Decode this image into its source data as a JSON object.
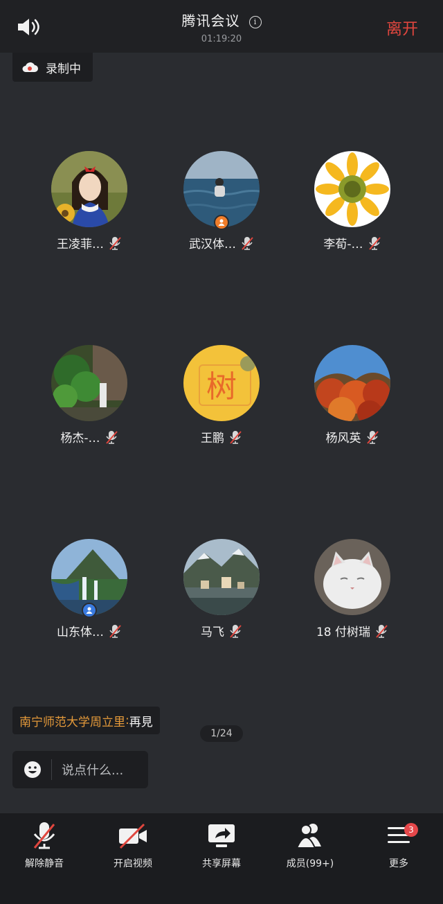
{
  "header": {
    "title": "腾讯会议",
    "timer": "01:19:20",
    "leave_label": "离开",
    "info_glyph": "i"
  },
  "recording": {
    "label": "录制中"
  },
  "participants": [
    {
      "name": "王凌菲…",
      "avatar": "woman-cartoon",
      "host": false
    },
    {
      "name": "武汉体…",
      "avatar": "man-in-sea",
      "host": true,
      "host_color": "#f07d2a"
    },
    {
      "name": "李荀-…",
      "avatar": "sunflower",
      "host": false
    },
    {
      "name": "杨杰-…",
      "avatar": "garden",
      "host": false
    },
    {
      "name": "王鹏",
      "avatar": "tree-character",
      "avatar_text": "树",
      "host": false
    },
    {
      "name": "杨风英",
      "avatar": "autumn-trees",
      "host": false
    },
    {
      "name": "山东体…",
      "avatar": "mountain-waterfall",
      "host": true,
      "host_color": "#3a7be0"
    },
    {
      "name": "马飞",
      "avatar": "lake-village",
      "host": false
    },
    {
      "name": "18 付树瑞",
      "avatar": "white-cat",
      "host": false
    }
  ],
  "chat": {
    "sender": "南宁师范大学周立里",
    "separator": ":",
    "message": "再見",
    "input_placeholder": "说点什么..."
  },
  "pager": "1/24",
  "toolbar": {
    "unmute": "解除静音",
    "start_video": "开启视频",
    "share_screen": "共享屏幕",
    "members": "成员(99+)",
    "more": "更多",
    "more_badge": "3"
  },
  "colors": {
    "leave": "#e0463e",
    "chat_sender": "#e59a3a",
    "badge": "#e5474a"
  }
}
